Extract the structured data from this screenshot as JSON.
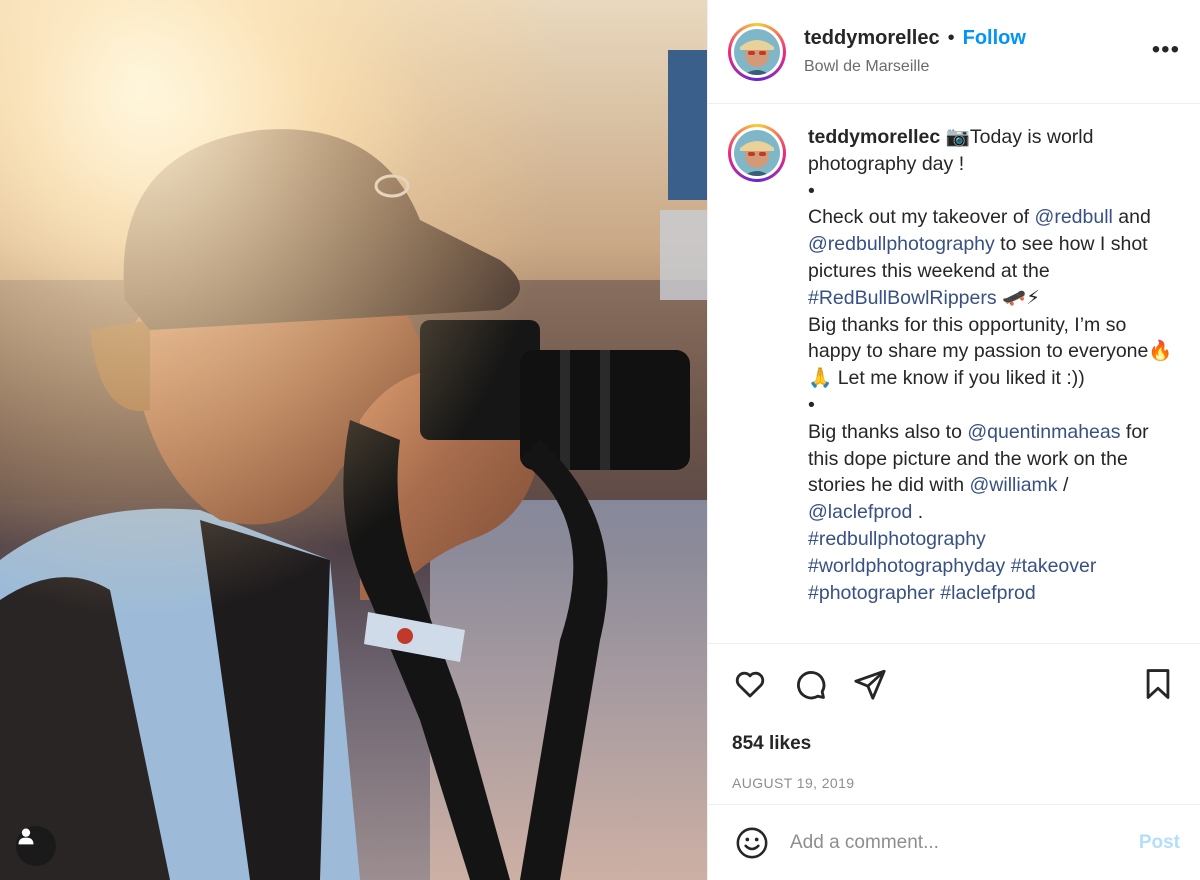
{
  "post": {
    "media_alt": "Photographer in cap shooting with a camera in sunlight",
    "header": {
      "username": "teddymorellec",
      "separator": "•",
      "follow_label": "Follow",
      "location": "Bowl de Marseille",
      "more_label": "•••"
    },
    "caption": {
      "username": "teddymorellec",
      "line1": " 📷Today is world photography day !",
      "bullet1": "•",
      "p2_a": "Check out my takeover of ",
      "mention_redbull": "@redbull",
      "p2_b": " and ",
      "mention_redbullphotography": "@redbullphotography",
      "p2_c": " to see how I shot pictures this weekend at the ",
      "hashtag_bowlrippers": "#RedBullBowlRippers",
      "p2_emoji": " 🛹⚡",
      "p3": "Big thanks for this opportunity, I’m so happy to share my passion to everyone🔥🙏 Let me know if you liked it :))",
      "bullet2": "•",
      "p4_a": "Big thanks also to ",
      "mention_quentinmaheas": "@quentinmaheas",
      "p4_b": " for this dope picture and the work on the stories he did with ",
      "mention_williamk": "@williamk",
      "p4_c": " / ",
      "mention_laclefprod": "@laclefprod",
      "p4_d": " .",
      "tag1": "#redbullphotography",
      "tag2": "#worldphotographyday",
      "tag3": "#takeover",
      "tag4": "#photographer",
      "tag5": "#laclefprod"
    },
    "likes": "854 likes",
    "date": "AUGUST 19, 2019",
    "comment": {
      "placeholder": "Add a comment...",
      "post_label": "Post"
    },
    "icons": {
      "like": "heart-icon",
      "comment": "comment-bubble-icon",
      "share": "paper-plane-icon",
      "save": "bookmark-icon",
      "emoji": "smiley-icon",
      "user_tag": "person-icon"
    },
    "colors": {
      "follow": "#0095f6",
      "link": "#385185",
      "post_disabled": "#b2dffc",
      "meta": "#8e8e8e"
    }
  }
}
